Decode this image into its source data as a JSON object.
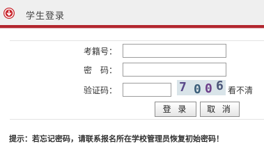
{
  "header": {
    "title": "学生登录",
    "icon": "download-arrow-icon",
    "accent_color": "#b3262e"
  },
  "form": {
    "exam_number_label": "考籍号：",
    "exam_number_value": "",
    "password_label": "密　码：",
    "password_value": "",
    "captcha_label": "验证码：",
    "captcha_value": "",
    "captcha_digits": [
      "7",
      "0",
      "0",
      "6"
    ],
    "refresh_label": "看不清",
    "login_button": "登 录",
    "cancel_button": "取 消"
  },
  "footer": {
    "tip": "提示：若忘记密码，请联系报名所在学校管理员恢复初始密码！"
  }
}
